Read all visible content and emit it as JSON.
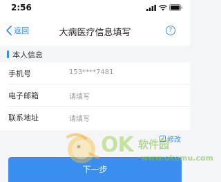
{
  "status_bar": {
    "time": "2:56"
  },
  "nav": {
    "back_label": "返回",
    "title": "大病医疗信息填写",
    "help_label": "?"
  },
  "section": {
    "title": "本人信息"
  },
  "form": {
    "rows": [
      {
        "label": "手机号",
        "value": "153****7481"
      },
      {
        "label": "电子邮箱",
        "value": "请填写"
      },
      {
        "label": "联系地址",
        "value": "请填写"
      }
    ]
  },
  "edit_label": "修改",
  "next_button_label": "下一步",
  "watermark": {
    "brand": "OK",
    "sub": "软件园",
    "url": "www.okemu.com"
  },
  "colors": {
    "accent": "#3a8ef0",
    "placeholder": "#999999",
    "background": "#f4f5f7"
  }
}
